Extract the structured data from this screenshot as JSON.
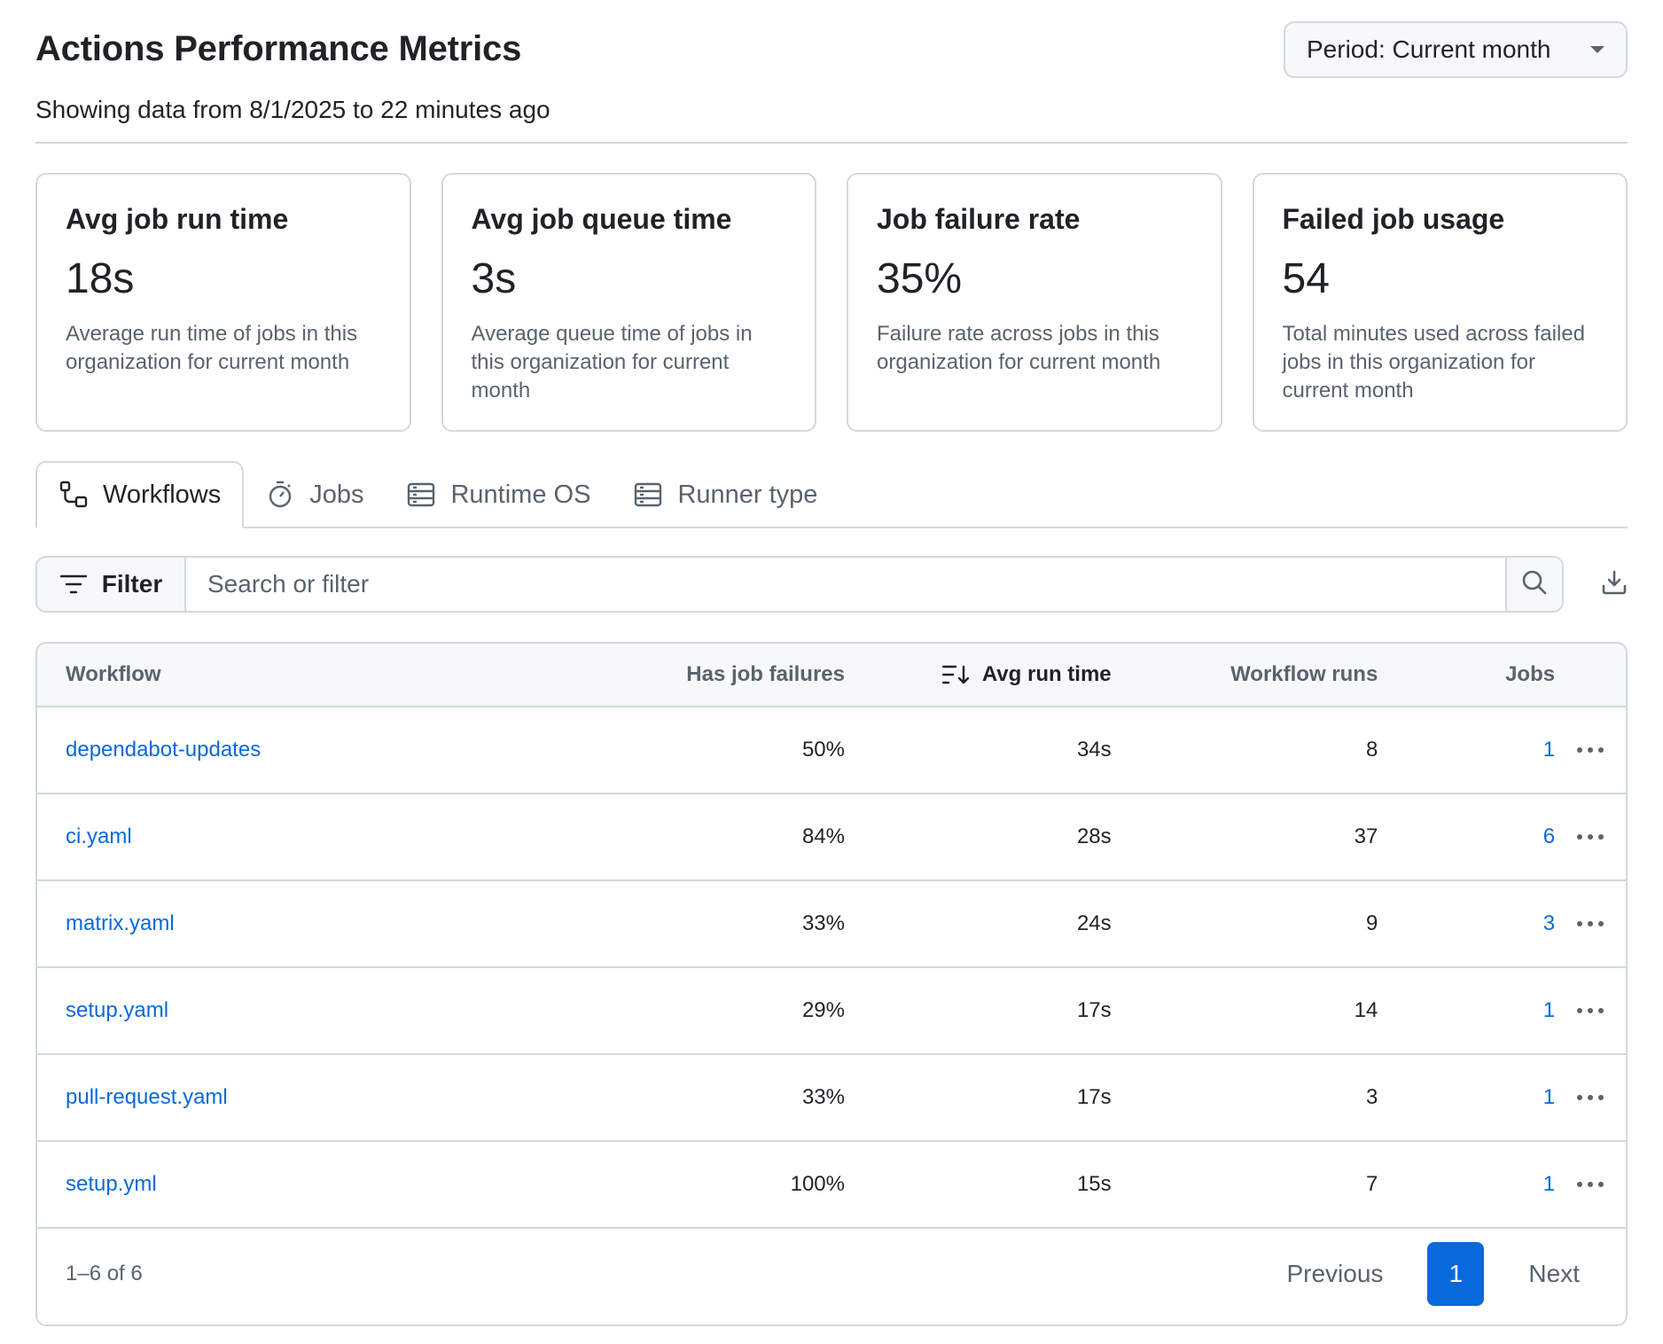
{
  "header": {
    "title": "Actions Performance Metrics",
    "subtitle": "Showing data from 8/1/2025 to 22 minutes ago",
    "period_label": "Period: Current month"
  },
  "cards": [
    {
      "title": "Avg job run time",
      "value": "18s",
      "description": "Average run time of jobs in this organization for current month"
    },
    {
      "title": "Avg job queue time",
      "value": "3s",
      "description": "Average queue time of jobs in this organization for current month"
    },
    {
      "title": "Job failure rate",
      "value": "35%",
      "description": "Failure rate across jobs in this organization for current month"
    },
    {
      "title": "Failed job usage",
      "value": "54",
      "description": "Total minutes used across failed jobs in this organization for current month"
    }
  ],
  "tabs": [
    {
      "label": "Workflows",
      "icon": "workflow-icon",
      "active": true
    },
    {
      "label": "Jobs",
      "icon": "stopwatch-icon",
      "active": false
    },
    {
      "label": "Runtime OS",
      "icon": "server-icon",
      "active": false
    },
    {
      "label": "Runner type",
      "icon": "server-icon",
      "active": false
    }
  ],
  "filter": {
    "button_label": "Filter",
    "placeholder": "Search or filter"
  },
  "table": {
    "columns": {
      "workflow": "Workflow",
      "failures": "Has job failures",
      "runtime": "Avg run time",
      "runs": "Workflow runs",
      "jobs": "Jobs"
    },
    "sorted_column": "runtime",
    "rows": [
      {
        "workflow": "dependabot-updates",
        "failures": "50%",
        "runtime": "34s",
        "runs": "8",
        "jobs": "1"
      },
      {
        "workflow": "ci.yaml",
        "failures": "84%",
        "runtime": "28s",
        "runs": "37",
        "jobs": "6"
      },
      {
        "workflow": "matrix.yaml",
        "failures": "33%",
        "runtime": "24s",
        "runs": "9",
        "jobs": "3"
      },
      {
        "workflow": "setup.yaml",
        "failures": "29%",
        "runtime": "17s",
        "runs": "14",
        "jobs": "1"
      },
      {
        "workflow": "pull-request.yaml",
        "failures": "33%",
        "runtime": "17s",
        "runs": "3",
        "jobs": "1"
      },
      {
        "workflow": "setup.yml",
        "failures": "100%",
        "runtime": "15s",
        "runs": "7",
        "jobs": "1"
      }
    ]
  },
  "pagination": {
    "summary": "1–6 of 6",
    "previous_label": "Previous",
    "current_page": "1",
    "next_label": "Next"
  },
  "colors": {
    "accent": "#0969da",
    "border": "#d1d9e0",
    "muted_text": "#59636e",
    "header_bg": "#f6f8fa"
  }
}
